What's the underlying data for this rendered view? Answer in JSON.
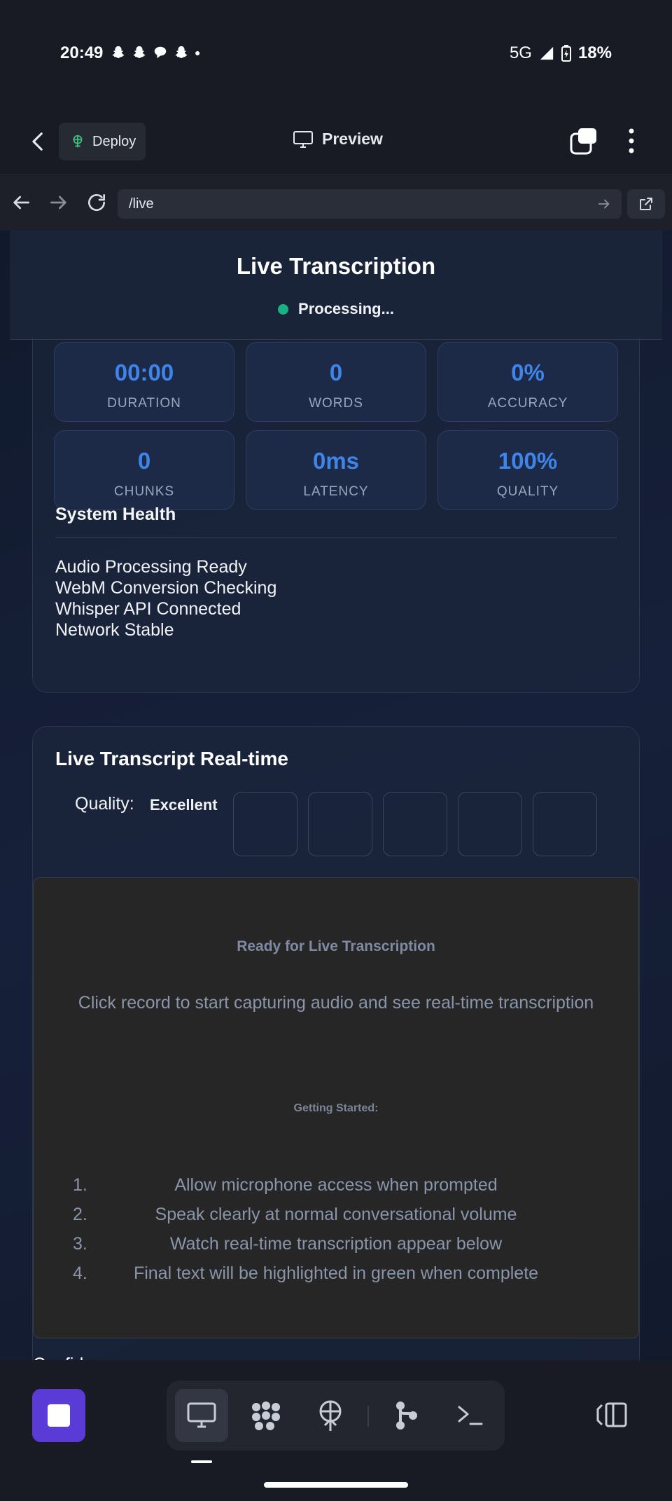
{
  "status_bar": {
    "time": "20:49",
    "network": "5G",
    "battery": "18%",
    "notification_icons": [
      "snapchat-icon",
      "snapchat-icon",
      "chat-icon",
      "snapchat-icon"
    ]
  },
  "header": {
    "deploy_label": "Deploy",
    "preview_label": "Preview"
  },
  "browser": {
    "url": "/live"
  },
  "live": {
    "title": "Live Transcription",
    "status": "Processing...",
    "status_color": "#19b184"
  },
  "stats": [
    {
      "value": "00:00",
      "label": "DURATION"
    },
    {
      "value": "0",
      "label": "WORDS"
    },
    {
      "value": "0%",
      "label": "ACCURACY"
    },
    {
      "value": "0",
      "label": "CHUNKS"
    },
    {
      "value": "0ms",
      "label": "LATENCY"
    },
    {
      "value": "100%",
      "label": "QUALITY"
    }
  ],
  "system_health": {
    "title": "System Health",
    "items": [
      "Audio Processing Ready",
      "WebM Conversion Checking",
      "Whisper API Connected",
      "Network Stable"
    ]
  },
  "transcript": {
    "title": "Live Transcript Real-time",
    "quality_label": "Quality:",
    "quality_value": "Excellent",
    "ready_title": "Ready for Live Transcription",
    "ready_description": "Click record to start capturing audio and see real-time transcription",
    "getting_started_title": "Getting Started:",
    "steps": [
      {
        "num": "1.",
        "text": "Allow microphone access when prompted"
      },
      {
        "num": "2.",
        "text": "Speak clearly at normal conversational volume"
      },
      {
        "num": "3.",
        "text": "Watch real-time transcription appear below"
      },
      {
        "num": "4.",
        "text": "Final text will be highlighted in green when complete"
      }
    ],
    "confidence_label": "Confidence"
  },
  "colors": {
    "accent": "#3f84e8",
    "stop_button": "#5b3bd6"
  }
}
